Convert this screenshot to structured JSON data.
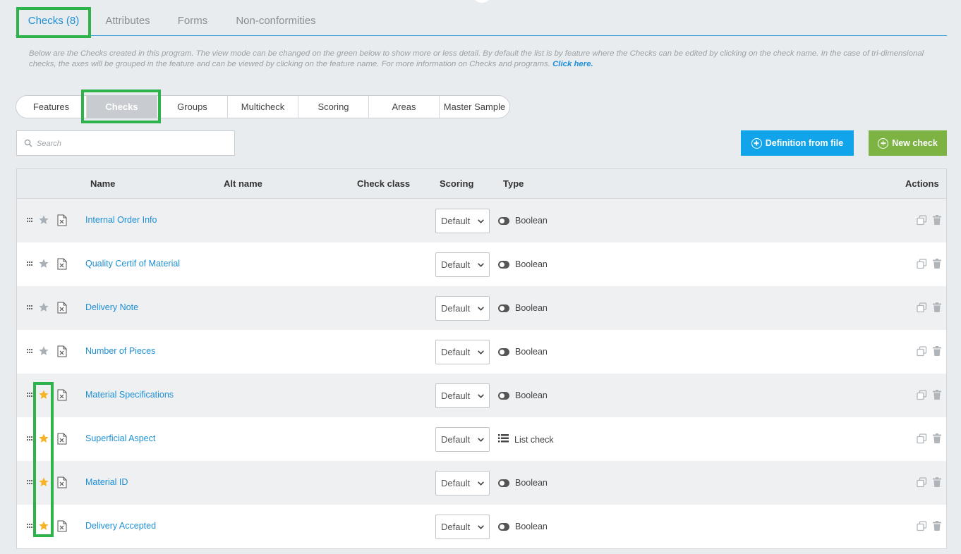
{
  "tabs": [
    {
      "label": "Checks (8)",
      "active": true
    },
    {
      "label": "Attributes",
      "active": false
    },
    {
      "label": "Forms",
      "active": false
    },
    {
      "label": "Non-conformities",
      "active": false
    }
  ],
  "info": {
    "text": "Below are the Checks created in this program. The view mode can be changed on the green below to show more or less detail. By default the list is by feature where the Checks can be edited by clicking on the check name. In the case of tri-dimensional checks, the axes will be grouped in the feature and can be viewed by clicking on the feature name. For more information on Checks and programs.",
    "link": "Click here."
  },
  "view_modes": [
    {
      "label": "Features",
      "active": false
    },
    {
      "label": "Checks",
      "active": true
    },
    {
      "label": "Groups",
      "active": false
    },
    {
      "label": "Multicheck",
      "active": false
    },
    {
      "label": "Scoring",
      "active": false
    },
    {
      "label": "Areas",
      "active": false
    },
    {
      "label": "Master Sample",
      "active": false
    }
  ],
  "search": {
    "placeholder": "Search",
    "value": ""
  },
  "buttons": {
    "definition_from_file": "Definition from file",
    "new_check": "New check"
  },
  "table": {
    "headers": {
      "name": "Name",
      "alt_name": "Alt name",
      "check_class": "Check class",
      "scoring": "Scoring",
      "type": "Type",
      "actions": "Actions"
    },
    "rows": [
      {
        "name": "Internal Order Info",
        "starred": false,
        "scoring": "Default",
        "type": "Boolean",
        "type_icon": "toggle-icon"
      },
      {
        "name": "Quality Certif of Material",
        "starred": false,
        "scoring": "Default",
        "type": "Boolean",
        "type_icon": "toggle-icon"
      },
      {
        "name": "Delivery Note",
        "starred": false,
        "scoring": "Default",
        "type": "Boolean",
        "type_icon": "toggle-icon"
      },
      {
        "name": "Number of Pieces",
        "starred": false,
        "scoring": "Default",
        "type": "Boolean",
        "type_icon": "toggle-icon"
      },
      {
        "name": "Material Specifications",
        "starred": true,
        "scoring": "Default",
        "type": "Boolean",
        "type_icon": "toggle-icon"
      },
      {
        "name": "Superficial Aspect",
        "starred": true,
        "scoring": "Default",
        "type": "List check",
        "type_icon": "list-icon"
      },
      {
        "name": "Material ID",
        "starred": true,
        "scoring": "Default",
        "type": "Boolean",
        "type_icon": "toggle-icon"
      },
      {
        "name": "Delivery Accepted",
        "starred": true,
        "scoring": "Default",
        "type": "Boolean",
        "type_icon": "toggle-icon"
      }
    ]
  },
  "colors": {
    "accent_blue": "#1e8fd6",
    "button_blue": "#12a4ea",
    "button_green": "#7cb342",
    "highlight_green": "#2db34a",
    "star_active": "#f5b325",
    "star_inactive": "#a8b0b8"
  }
}
